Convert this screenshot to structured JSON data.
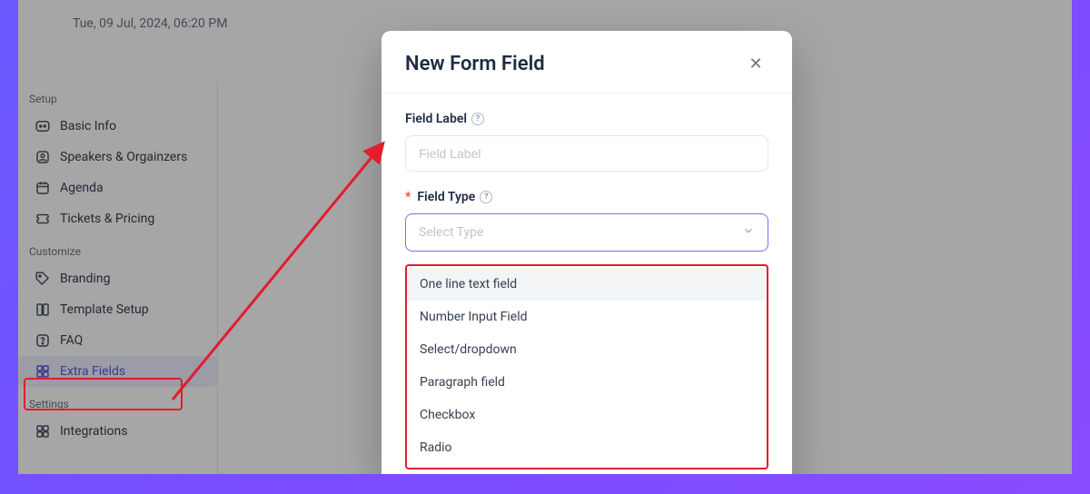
{
  "topbar": {
    "datetime": "Tue, 09 Jul, 2024, 06:20 PM"
  },
  "sidebar": {
    "setup_label": "Setup",
    "customize_label": "Customize",
    "settings_label": "Settings",
    "items": {
      "basic_info": "Basic Info",
      "speakers": "Speakers & Orgainzers",
      "agenda": "Agenda",
      "tickets": "Tickets & Pricing",
      "branding": "Branding",
      "template": "Template Setup",
      "faq": "FAQ",
      "extra_fields": "Extra Fields",
      "integrations": "Integrations"
    }
  },
  "modal": {
    "title": "New Form Field",
    "field_label_caption": "Field Label",
    "field_label_placeholder": "Field Label",
    "field_type_caption": "Field Type",
    "field_type_placeholder": "Select Type",
    "options": [
      "One line text field",
      "Number Input Field",
      "Select/dropdown",
      "Paragraph field",
      "Checkbox",
      "Radio"
    ]
  }
}
